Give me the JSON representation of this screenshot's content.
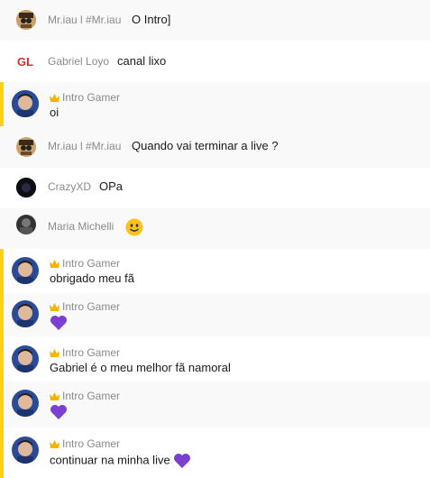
{
  "messages": [
    {
      "author": "Mr.iau l #Mr.iau",
      "text": "O Intro]"
    },
    {
      "author": "Gabriel Loyo",
      "text": "canal lixo",
      "avatar_text": "GL"
    },
    {
      "author": "Intro Gamer",
      "text": "oi"
    },
    {
      "author": "Mr.iau l #Mr.iau",
      "text": "Quando vai terminar a live ?"
    },
    {
      "author": "CrazyXD",
      "text": "OPa"
    },
    {
      "author": "Maria Michelli",
      "text": ""
    },
    {
      "author": "Intro Gamer",
      "text": "obrigado meu fã"
    },
    {
      "author": "Intro Gamer",
      "text": ""
    },
    {
      "author": "Intro Gamer",
      "text": "Gabriel é o meu melhor fã namoral"
    },
    {
      "author": "Intro Gamer",
      "text": ""
    },
    {
      "author": "Intro Gamer",
      "text": "continuar na minha live"
    }
  ],
  "colors": {
    "owner_accent": "#fcd116",
    "heart": "#7b3fd1",
    "logo_red": "#d32f2f"
  },
  "icons": {
    "crown": "crown-icon",
    "heart": "purple-heart-icon",
    "emoji": "smiling-face-icon"
  }
}
